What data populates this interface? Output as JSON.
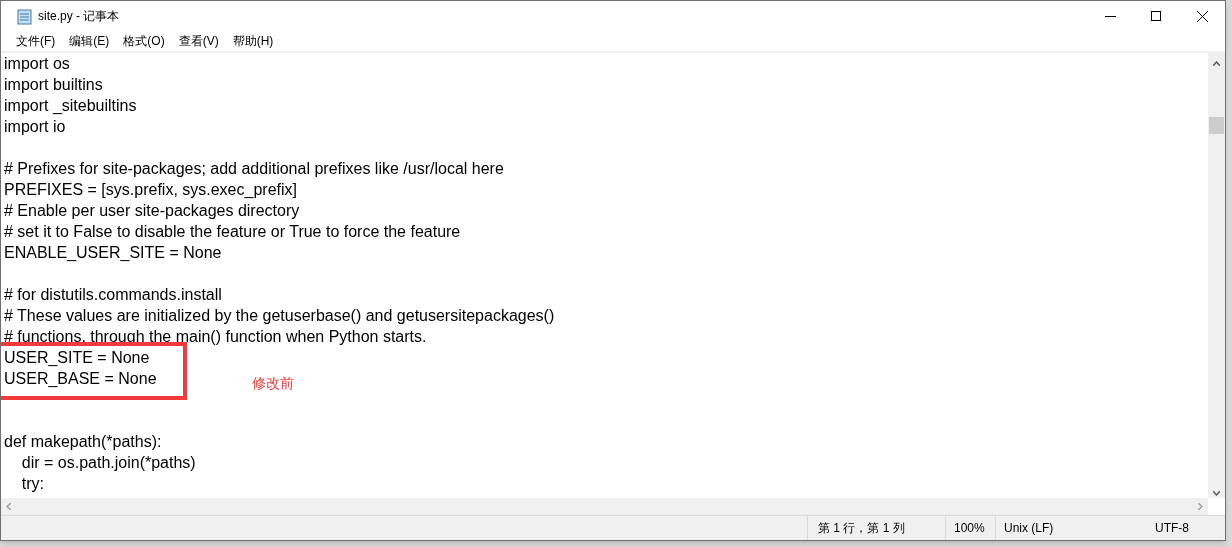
{
  "window": {
    "title": "site.py - 记事本"
  },
  "menu": [
    "文件(F)",
    "编辑(E)",
    "格式(O)",
    "查看(V)",
    "帮助(H)"
  ],
  "lines": [
    {
      "kind": "code",
      "text": "import os"
    },
    {
      "kind": "code",
      "text": "import builtins"
    },
    {
      "kind": "code",
      "text": "import _sitebuiltins"
    },
    {
      "kind": "code",
      "text": "import io"
    },
    {
      "kind": "blank"
    },
    {
      "kind": "code",
      "text": "# Prefixes for site-packages; add additional prefixes like /usr/local here"
    },
    {
      "kind": "code",
      "text": "PREFIXES = [sys.prefix, sys.exec_prefix]"
    },
    {
      "kind": "code",
      "text": "# Enable per user site-packages directory"
    },
    {
      "kind": "code",
      "text": "# set it to False to disable the feature or True to force the feature"
    },
    {
      "kind": "code",
      "text": "ENABLE_USER_SITE = None"
    },
    {
      "kind": "blank"
    },
    {
      "kind": "code",
      "text": "# for distutils.commands.install"
    },
    {
      "kind": "code",
      "text": "# These values are initialized by the getuserbase() and getusersitepackages()"
    },
    {
      "kind": "code",
      "text": "# functions, through the main() function when Python starts."
    },
    {
      "kind": "code",
      "text": "USER_SITE = None"
    },
    {
      "kind": "code",
      "text": "USER_BASE = None"
    },
    {
      "kind": "blank"
    },
    {
      "kind": "blank"
    },
    {
      "kind": "code",
      "text": "def makepath(*paths):"
    },
    {
      "kind": "code",
      "text": "    dir = os.path.join(*paths)"
    },
    {
      "kind": "code",
      "text": "    try:"
    }
  ],
  "annotation": {
    "note": "修改前"
  },
  "status_bar": {
    "position": "第 1 行，第 1 列",
    "zoom": "100%",
    "line_ending": "Unix (LF)",
    "encoding": "UTF-8"
  }
}
